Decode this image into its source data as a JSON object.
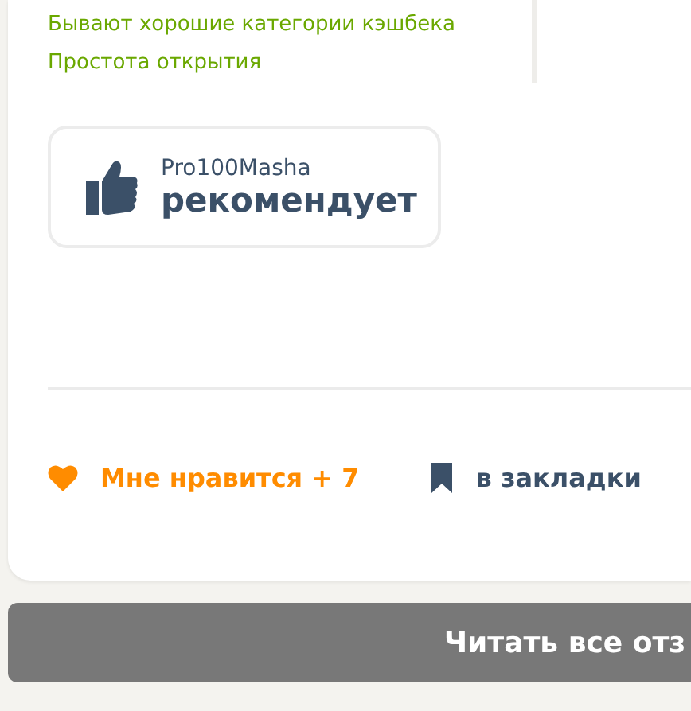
{
  "pros": [
    "Бывают хорошие категории кэшбека",
    "Простота открытия"
  ],
  "recommendation": {
    "author": "Pro100Masha",
    "verdict": "рекомендует"
  },
  "actions": {
    "like": {
      "label": "Мне нравится + 7",
      "liked": true
    },
    "bookmark": {
      "label": "в закладки"
    }
  },
  "read_all_button": "Читать все отз"
}
